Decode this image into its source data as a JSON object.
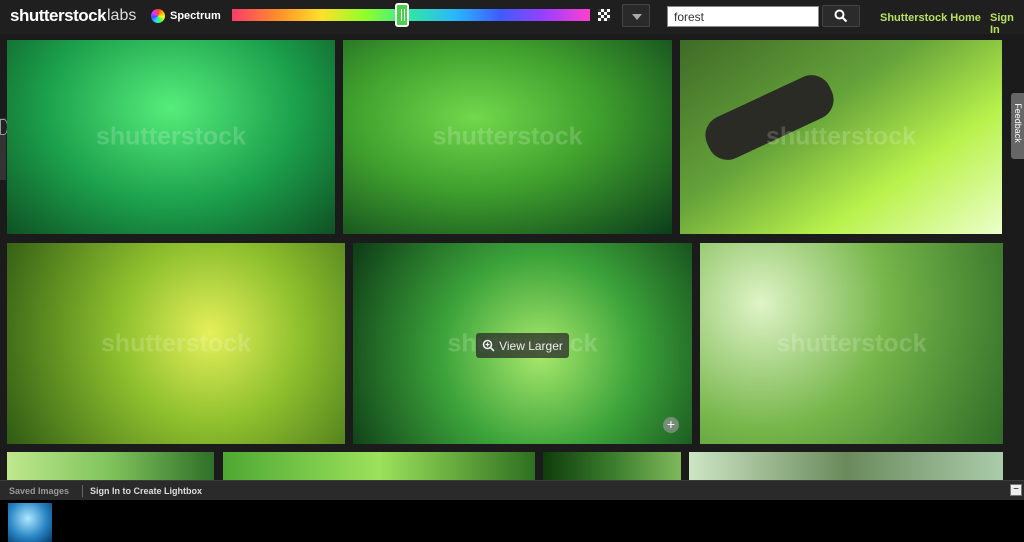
{
  "header": {
    "logo": "shutterstock",
    "labs": "labs",
    "spectrum_label": "Spectrum",
    "search_value": "forest",
    "home_link": "Shutterstock Home",
    "signin_link": "Sign In"
  },
  "watermark_text": "shutterstock",
  "overlay": {
    "view_larger": "View Larger"
  },
  "sidebar": {
    "feedback": "Feedback"
  },
  "footer": {
    "saved_images": "Saved Images",
    "signin_lightbox": "Sign In to Create Lightbox",
    "collapse_symbol": "−"
  },
  "colors": {
    "accent_link": "#b9e05e",
    "background": "#1b1b1b"
  }
}
